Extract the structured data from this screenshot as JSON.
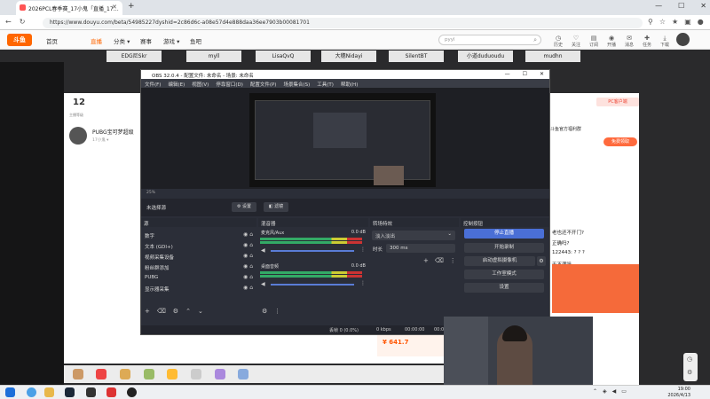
{
  "browser": {
    "tab_title": "2026PCL春季赛_17小鬼「直播_17…",
    "new_tab": "+",
    "url": "https://www.douyu.com/beta/54985227dyshid=2c86d6c-a08e57d4e888daa36ee7903b00081701",
    "controls": [
      "—",
      "☐",
      "✕"
    ]
  },
  "site": {
    "logo": "斗鱼",
    "nav": [
      "首页",
      "直播",
      "分类 ▾",
      "赛事",
      "游戏 ▾",
      "鱼吧"
    ],
    "search_placeholder": "pyyl",
    "header_icons": [
      "历史",
      "关注",
      "订阅",
      "开播",
      "消息",
      "任务",
      "下载"
    ],
    "stripe_tags": [
      "EDG尼Skr",
      "myll",
      "LisaQvQ",
      "大穗Nidayi",
      "SilentBT",
      "小道duduoudu",
      "mudhn"
    ],
    "level_number": "12",
    "level_label": "主播等级",
    "room_title": "PUBG宝可梦超级",
    "room_sub": "17小鬼 ▾",
    "pc_download": "PC客户端",
    "right_header": "斗鱼官方福利群",
    "right_btn": "免费领取",
    "chat_lines": [
      "老也还不开门?",
      "正确吗?",
      "122443: ? ? ?",
      "天不满吗"
    ],
    "price": "¥ 641.7"
  },
  "obs": {
    "title": "OBS 32.0.4 - 配置文件: 未命名 - 场景: 未命名",
    "menu": [
      "文件(F)",
      "编辑(E)",
      "视图(V)",
      "停靠窗口(D)",
      "配置文件(P)",
      "场景集合(S)",
      "工具(T)",
      "帮助(H)"
    ],
    "zoom": "25%",
    "scene_label": "未选择源",
    "settings_btn": "设置",
    "filters_btn": "滤镜",
    "docks": {
      "sources": "源",
      "mixer": "混音器",
      "transitions": "转场特效",
      "controls": "控制按钮"
    },
    "sources": [
      "数字",
      "文本 (GDI+)",
      "视频采集设备",
      "粉丝群添加",
      "PUBG",
      "显示器采集"
    ],
    "mixer": [
      {
        "name": "麦克风/Aux",
        "db": "0.0 dB"
      },
      {
        "name": "桌面音频",
        "db": "0.0 dB"
      }
    ],
    "transition_type": "淡入淡出",
    "duration_label": "时长",
    "duration_value": "300 ms",
    "control_buttons": [
      "停止直播",
      "开始录制",
      "启动虚拟摄像机",
      "工作室模式",
      "设置"
    ],
    "status": {
      "dropped": "丢帧 0 (0.0%)",
      "kbps": "0 kbps",
      "time": "00:00:00",
      "cpu": "00:00:00"
    }
  },
  "taskbar": {
    "time": "19:00",
    "date": "2026/4/13"
  }
}
